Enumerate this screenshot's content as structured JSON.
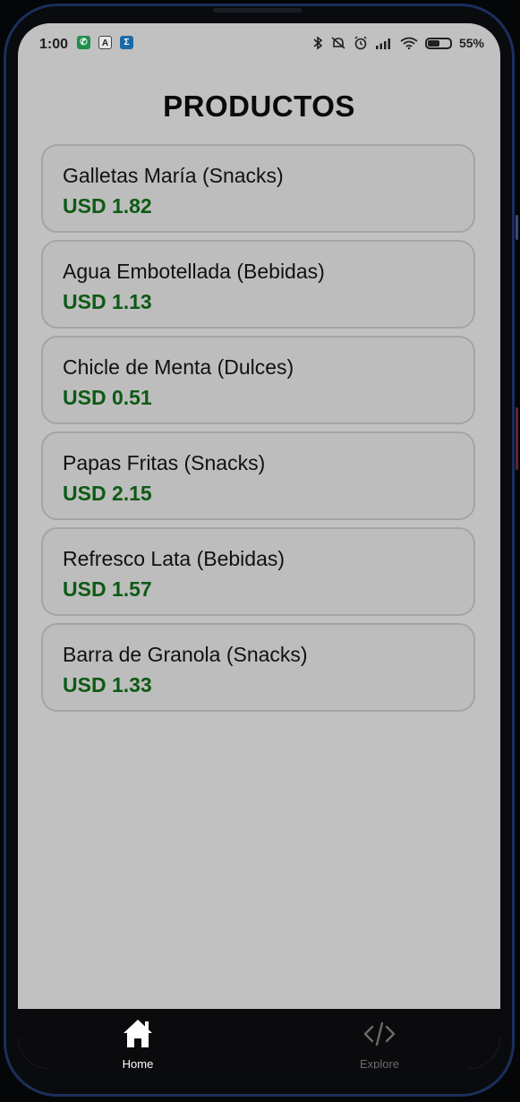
{
  "status_bar": {
    "time": "1:00",
    "battery_percent": "55%",
    "battery_level": 0.55,
    "left_icons": [
      "whatsapp-icon",
      "app-a-icon",
      "app-sigma-icon"
    ],
    "right_icons": [
      "bluetooth-icon",
      "alarm-off-icon",
      "alarm-icon",
      "signal-icon",
      "wifi-icon",
      "battery-icon"
    ]
  },
  "page": {
    "title": "PRODUCTOS"
  },
  "products": [
    {
      "name": "Galletas María (Snacks)",
      "price": "USD 1.82"
    },
    {
      "name": "Agua Embotellada (Bebidas)",
      "price": "USD 1.13"
    },
    {
      "name": "Chicle de Menta (Dulces)",
      "price": "USD 0.51"
    },
    {
      "name": "Papas Fritas (Snacks)",
      "price": "USD 2.15"
    },
    {
      "name": "Refresco Lata (Bebidas)",
      "price": "USD 1.57"
    },
    {
      "name": "Barra de Granola (Snacks)",
      "price": "USD 1.33"
    }
  ],
  "bottom_nav": {
    "items": [
      {
        "label": "Home",
        "icon": "home-icon",
        "active": true
      },
      {
        "label": "Explore",
        "icon": "code-icon",
        "active": false
      }
    ]
  },
  "colors": {
    "background": "#c1c1c1",
    "card_border": "#a4a4a4",
    "price_green": "#0d5a14",
    "nav_bg": "#0b0b0d"
  }
}
